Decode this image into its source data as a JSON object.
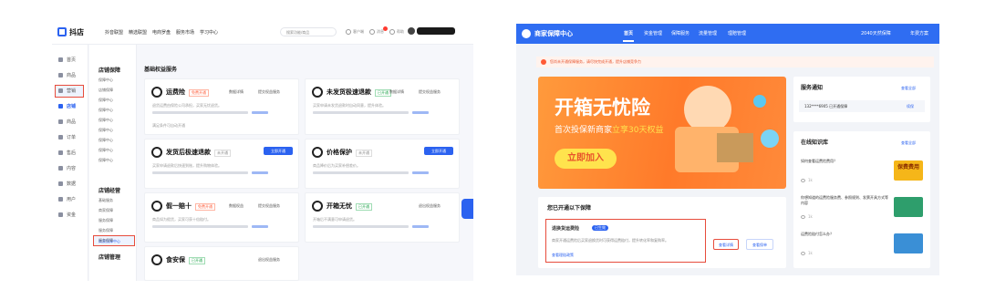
{
  "left": {
    "app_name": "抖店",
    "top_nav": [
      "抖音联盟",
      "精选联盟",
      "电商罗盘",
      "服务市场",
      "学习中心"
    ],
    "search_placeholder": "搜索功能/商品",
    "top_right": [
      "客户端",
      "消息",
      "帮助"
    ],
    "rail": [
      {
        "label": "首页",
        "icon": "home-icon"
      },
      {
        "label": "商品",
        "icon": "product-icon"
      },
      {
        "label": "营销",
        "icon": "marketing-icon"
      },
      {
        "label": "店铺",
        "icon": "store-icon",
        "active": true
      },
      {
        "label": "商品",
        "icon": "goods-icon"
      },
      {
        "label": "订单",
        "icon": "order-icon"
      },
      {
        "label": "售后",
        "icon": "aftersale-icon"
      },
      {
        "label": "内容",
        "icon": "content-icon"
      },
      {
        "label": "数据",
        "icon": "data-icon"
      },
      {
        "label": "用户",
        "icon": "user-icon"
      },
      {
        "label": "资金",
        "icon": "fund-icon"
      }
    ],
    "subnav_heading_1": "店铺保障",
    "subnav_items_1": [
      "保障中心",
      "店铺保障",
      "保障中心",
      "保障中心",
      "保障中心",
      "保障中心",
      "保障中心",
      "保障中心",
      "保障中心"
    ],
    "subnav_heading_2": "店铺经营",
    "subnav_items_2": [
      "基础服务",
      "商家保障",
      "服务保障",
      "服务保障",
      "服务保障",
      "服务保障"
    ],
    "subnav_highlight": "商家保障中心",
    "subnav_heading_3": "店铺管理",
    "section_title": "基础权益服务",
    "cards": [
      {
        "title": "运费险",
        "tag": "免费开通",
        "tag_kind": "orange",
        "links": [
          "数据详情",
          "提交权益服务"
        ],
        "desc": "退货运费由保险公司承担，买家无忧退货。",
        "desc2": "满足条件可自动开通",
        "icon": "truck-icon"
      },
      {
        "title": "未发货极速退款",
        "tag": "已开通",
        "tag_kind": "green",
        "links": [
          "数据详情",
          "提交权益服务"
        ],
        "desc": "买家申请未发货退款时自动同意，提升体验。",
        "desc2": "",
        "icon": "refund-icon"
      },
      {
        "title": "发货后极速退款",
        "tag": "未开通",
        "tag_kind": "gray",
        "button": "立即开通",
        "desc": "买家申请退款后快速到账，提升购物体验。",
        "desc2": "",
        "icon": "refund-fast-icon"
      },
      {
        "title": "价格保护",
        "tag": "未开通",
        "tag_kind": "gray",
        "button": "立即开通",
        "desc": "商品降价后为买家补偿差价。",
        "desc2": "",
        "icon": "price-protect-icon"
      },
      {
        "title": "假一赔十",
        "tag": "免费开通",
        "tag_kind": "orange",
        "links": [
          "数据权益",
          "提交权益服务"
        ],
        "desc": "商品如为假货，买家可获十倍赔付。",
        "desc2": "",
        "icon": "fake-ten-icon"
      },
      {
        "title": "开箱无忧",
        "tag": "已开通",
        "tag_kind": "green",
        "links": [
          "退出权益服务"
        ],
        "desc": "开箱后不满意可申请退货。",
        "desc2": "",
        "icon": "unbox-icon"
      },
      {
        "title": "食安保",
        "tag": "已开通",
        "tag_kind": "green",
        "links": [
          "退出权益服务"
        ],
        "desc": "",
        "desc2": "",
        "icon": "food-safe-icon"
      }
    ]
  },
  "right": {
    "app_name": "商家保障中心",
    "top_nav": [
      "首页",
      "资金管理",
      "保障服务",
      "流量管理",
      "理赔管理"
    ],
    "top_right": [
      "2040天然保障",
      "年费方案"
    ],
    "notice": "您尚未开通保障服务，请尽快完成开通，提升店铺竞争力",
    "banner": {
      "headline": "开箱无忧险",
      "subline_prefix": "首次投保新商家",
      "subline_highlight": "立享30天权益",
      "cta": "立即加入"
    },
    "service_notice": {
      "title": "服务通知",
      "more": "查看全部",
      "item": "132****6905 已开通保障",
      "item_action": "续保"
    },
    "knowledge": {
      "title": "在线知识库",
      "more": "查看全部",
      "items": [
        {
          "q": "如何查看运费险费用？",
          "views": "1k",
          "thumb_text": "保费费用",
          "thumb_color": "#f5b619"
        },
        {
          "q": "你想知道的运费险服务费、参照规则、发票开具方式等内容",
          "views": "1k",
          "thumb_text": "",
          "thumb_color": "#2e9e6c"
        },
        {
          "q": "运费险赔付怎么办？",
          "views": "1k",
          "thumb_text": "",
          "thumb_color": "#3a8fd6"
        }
      ]
    },
    "opened": {
      "title": "您已开通以下保障",
      "item_title": "退换货运费险",
      "item_tag": "已生效",
      "item_desc": "商家开通运费险后买家退换货时可获得运费赔付，提升转化率和复购率。",
      "item_link": "查看理赔政策",
      "btn_1": "查看详情",
      "btn_2": "查看保单"
    }
  },
  "colors": {
    "accent": "#2b62f0",
    "highlight_box": "#e74c3c",
    "banner_orange": "#ff8a2f"
  }
}
